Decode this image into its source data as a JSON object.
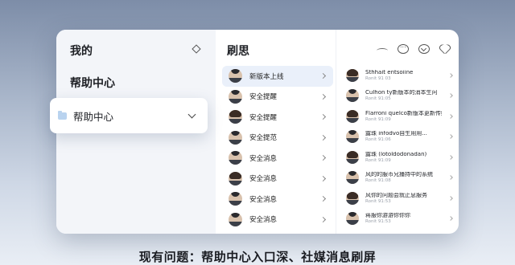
{
  "left": {
    "title": "我的",
    "heading": "帮助中心",
    "card_label": "帮助中心"
  },
  "middle": {
    "title": "刷思",
    "items": [
      {
        "label": "新版本上线",
        "active": true
      },
      {
        "label": "安全提醒"
      },
      {
        "label": "安全提醒"
      },
      {
        "label": "安全提范"
      },
      {
        "label": "安全消息"
      },
      {
        "label": "安全消息"
      },
      {
        "label": "安全消息"
      },
      {
        "label": "安全消息"
      }
    ]
  },
  "right": {
    "icons": [
      "wave-icon",
      "chat-bubble-icon",
      "download-circle-icon",
      "heart-icon"
    ],
    "items": [
      {
        "name": "Sthhait entsoiine",
        "sub": "Ronit 91 03"
      },
      {
        "name": "Culhon ty新版本的消本生问",
        "sub": "Ronit 91:05"
      },
      {
        "name": "Flarroni quelco新版本更新传统",
        "sub": "Ronit 91:09"
      },
      {
        "name": "露珠 infodvo自生用用...",
        "sub": "Ronit 91:06"
      },
      {
        "name": "露珠 (lotoldodonadan)",
        "sub": "Ronit 91:09"
      },
      {
        "name": "风的的服币兄播持中的系统",
        "sub": "Ronit 91:08"
      },
      {
        "name": "风你的问题会就止息服务",
        "sub": "Ronit 91:53"
      },
      {
        "name": "蒋服你游游你你你",
        "sub": "Ronit 91:53"
      }
    ]
  },
  "caption": "现有问题：帮助中心入口深、社媒消息刷屏"
}
